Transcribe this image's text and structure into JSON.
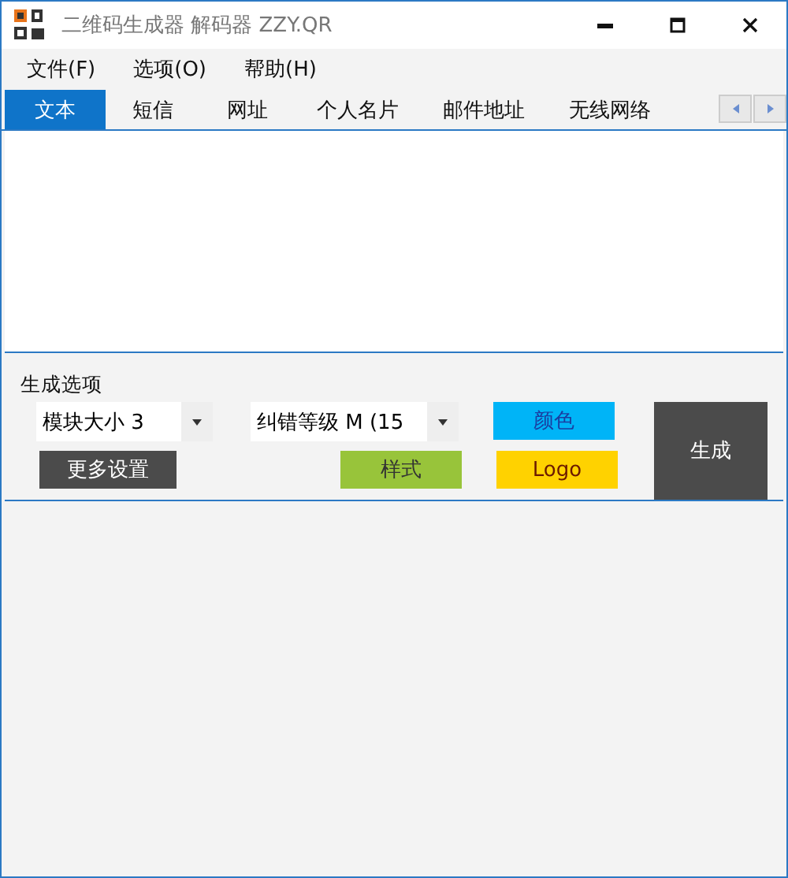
{
  "window": {
    "title": "二维码生成器 解码器 ZZY.QR"
  },
  "menu": [
    "文件(F)",
    "选项(O)",
    "帮助(H)"
  ],
  "tabs": [
    {
      "label": "文本",
      "selected": true
    },
    {
      "label": "短信",
      "selected": false
    },
    {
      "label": "网址",
      "selected": false
    },
    {
      "label": "个人名片",
      "selected": false
    },
    {
      "label": "邮件地址",
      "selected": false
    },
    {
      "label": "无线网络",
      "selected": false
    }
  ],
  "options": {
    "title": "生成选项",
    "module_size": {
      "value": "模块大小 3"
    },
    "error_level": {
      "value": "纠错等级 M (15"
    },
    "buttons": {
      "more": "更多设置",
      "style": "样式",
      "palette": "颜色",
      "logo": "Logo",
      "generate": "生成"
    }
  }
}
